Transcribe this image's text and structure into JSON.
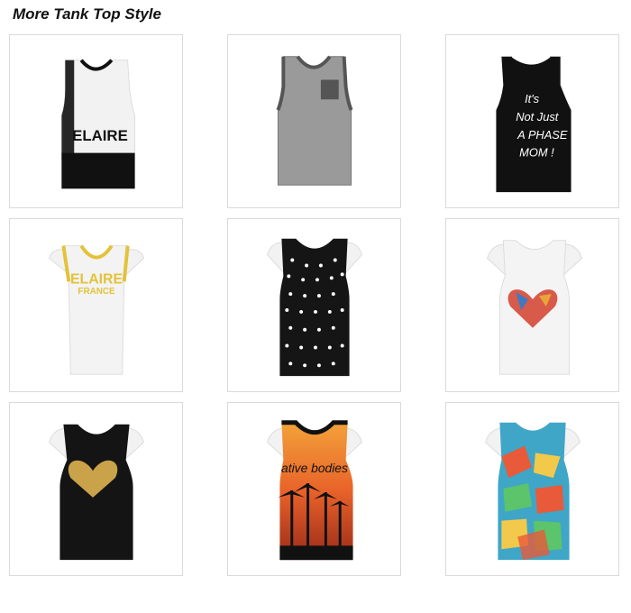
{
  "page": {
    "title": "More Tank Top Style"
  },
  "products": [
    {
      "id": "tank-1",
      "print_text": "ELAIRE",
      "colors": [
        "#f2f2f2",
        "#111111"
      ]
    },
    {
      "id": "tank-2",
      "print_text": "",
      "colors": [
        "#9a9a9a",
        "#555555"
      ]
    },
    {
      "id": "tank-3",
      "print_text_lines": [
        "It's",
        "Not Just",
        "A PHASE",
        "MOM !"
      ],
      "colors": [
        "#111111",
        "#ffffff"
      ]
    },
    {
      "id": "tank-4",
      "print_text_lines": [
        "ELAIRE",
        "FRANCE"
      ],
      "colors": [
        "#f3f3f3",
        "#e3c23a"
      ]
    },
    {
      "id": "tank-5",
      "print_text": "",
      "colors": [
        "#151515",
        "#ffffff"
      ]
    },
    {
      "id": "tank-6",
      "print_text": "",
      "colors": [
        "#f4f4f4",
        "#d85a4a"
      ]
    },
    {
      "id": "tank-7",
      "print_text": "",
      "colors": [
        "#141414",
        "#c9a24a"
      ]
    },
    {
      "id": "tank-8",
      "print_text": "ative bodies",
      "colors": [
        "#e8622a",
        "#111111"
      ]
    },
    {
      "id": "tank-9",
      "print_text": "",
      "colors": [
        "#3fa6c8",
        "#e85a3a"
      ]
    }
  ]
}
